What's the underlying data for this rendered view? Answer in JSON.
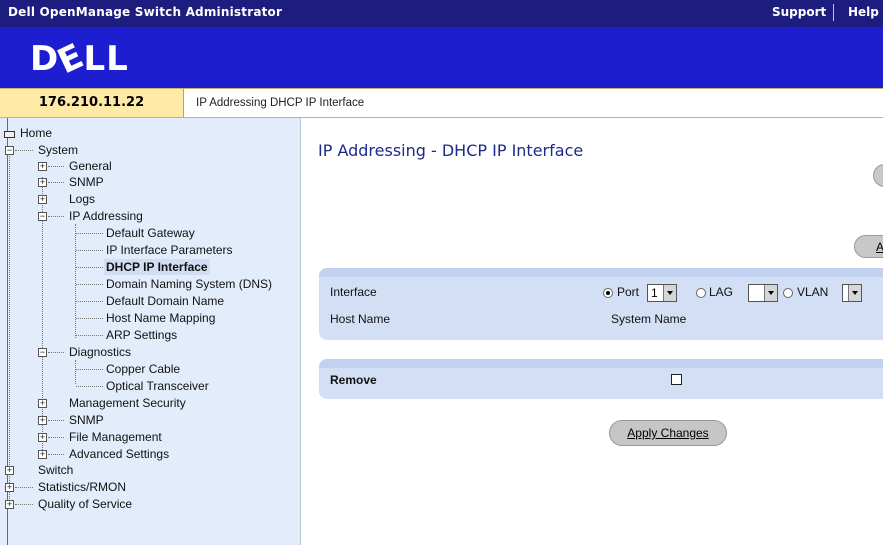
{
  "header": {
    "app_title": "Dell OpenManage Switch Administrator",
    "support_link": "Support",
    "help_link": "Help"
  },
  "banner": {
    "logo_text": "DELL"
  },
  "ip_address": "176.210.11.22",
  "breadcrumb": "IP Addressing  DHCP IP Interface",
  "sidebar": {
    "home": "Home",
    "system": "System",
    "general": "General",
    "snmp_sys": "SNMP",
    "logs": "Logs",
    "ip_addressing": "IP Addressing",
    "default_gateway": "Default Gateway",
    "ip_interface_parameters": "IP Interface Parameters",
    "dhcp_ip_interface": "DHCP IP Interface",
    "dns": "Domain Naming System (DNS)",
    "default_domain_name": "Default Domain Name",
    "host_name_mapping": "Host Name Mapping",
    "arp_settings": "ARP Settings",
    "diagnostics": "Diagnostics",
    "copper_cable": "Copper Cable",
    "optical_transceiver": "Optical Transceiver",
    "management_security": "Management Security",
    "snmp": "SNMP",
    "file_management": "File Management",
    "advanced_settings": "Advanced Settings",
    "switch": "Switch",
    "statistics_rmon": "Statistics/RMON",
    "quality_of_service": "Quality of Service"
  },
  "main": {
    "title": "IP Addressing - DHCP IP Interface",
    "add_button_letter": "A",
    "interface_label": "Interface",
    "port_label": "Port",
    "port_value": "1",
    "lag_label": "LAG",
    "vlan_label": "VLAN",
    "host_name_label": "Host Name",
    "host_name_value": "System Name",
    "remove_label": "Remove",
    "apply_button": "Apply Changes"
  }
}
